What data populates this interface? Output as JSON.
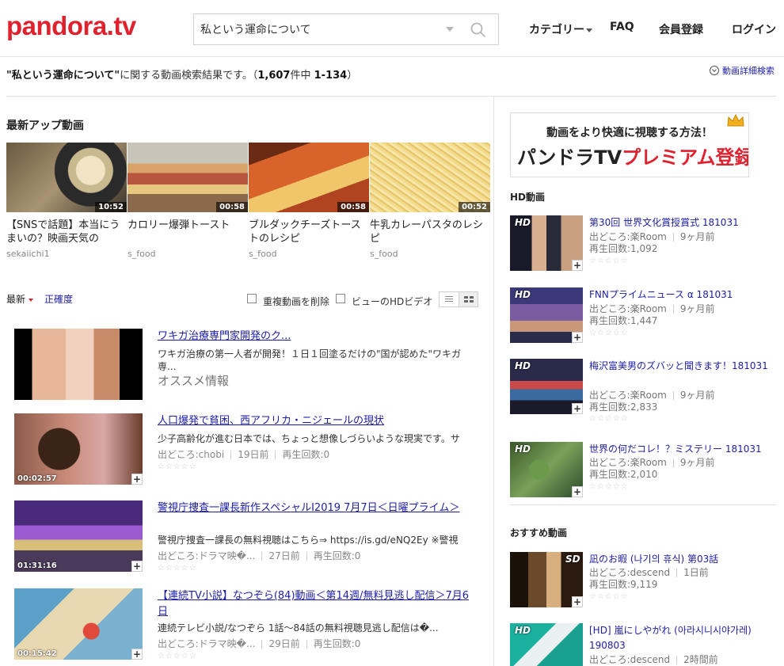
{
  "header": {
    "logo": "pandora.tv",
    "search_value": "私という運命について",
    "nav": {
      "category": "カテゴリー",
      "faq": "FAQ",
      "register": "会員登録",
      "login": "ログイン"
    }
  },
  "results": {
    "query_quoted": "\"私という運命について\"",
    "text": "に関する動画検索結果です。（",
    "total": "1,607",
    "of_label": "件中 ",
    "range": "1-134",
    "close": "）",
    "advanced": "動画詳細検索"
  },
  "latest": {
    "title": "最新アップ動画",
    "items": [
      {
        "title": "【SNSで話題】本当にうまいの？映画天気の",
        "channel": "sekaiichi1",
        "duration": "10:52"
      },
      {
        "title": "カロリー爆弾トースト",
        "channel": "s_food",
        "duration": "00:58"
      },
      {
        "title": "ブルダックチーズトーストのレシピ",
        "channel": "s_food",
        "duration": "00:58"
      },
      {
        "title": "牛乳カレーパスタのレシピ",
        "channel": "s_food",
        "duration": "00:52"
      }
    ]
  },
  "sortbar": {
    "newest": "最新",
    "accuracy": "正確度",
    "dedupe": "重複動画を削除",
    "hd_only": "ビューのHDビデオ"
  },
  "videos": [
    {
      "title": "ワキガ治療専門家開発のク...",
      "desc": "ワキガ治療の第一人者が開発！１日１回塗るだけの\"国が認めた\"ワキガ専...",
      "recommend": "オススメ情報"
    },
    {
      "title": "人口爆発で貧困、西アフリカ・ニジェールの現状",
      "desc": "少子高齢化が進む日本では、ちょっと想像しづらいような現実です。サ",
      "source": "出どころ:chobi",
      "date": "19日前",
      "views": "再生回数:0",
      "duration": "00:02:57"
    },
    {
      "title": "警視庁捜査一課長新作スペシャルⅠ2019 7月7日＜日曜プライム＞",
      "desc": "警視庁捜査一課長の無料視聴はこちら⇒ https://is.gd/eNQ2Ey ※警視",
      "source": "出どころ:ドラマ映�...",
      "date": "27日前",
      "views": "再生回数:0",
      "duration": "01:31:16"
    },
    {
      "title": "【連続TV小説】なつぞら(84)動画＜第14週/無料見逃し配信＞7月6日",
      "desc": "連続テレビ小説/なつぞら 1話～84話の無料視聴見逃し配信は�...",
      "source": "出どころ:ドラマ映�...",
      "date": "29日前",
      "views": "再生回数:0",
      "duration": "00:15:42"
    }
  ],
  "sidebar": {
    "banner_top": "動画をより快適に視聴する方法！",
    "banner_main_a": "パンドラTV",
    "banner_main_b": "プレミアム登録",
    "hd_title": "HD動画",
    "hd_items": [
      {
        "badge": "HD",
        "title": "第30回 世界文化賞授賞式 181031",
        "source": "出どころ:楽Room",
        "date": "9ヶ月前",
        "views": "再生回数:1,092"
      },
      {
        "badge": "HD",
        "title": "FNNプライムニュース α 181031",
        "source": "出どころ:楽Room",
        "date": "9ヶ月前",
        "views": "再生回数:1,447"
      },
      {
        "badge": "HD",
        "title": "梅沢富美男のズバッと聞きます！181031",
        "source": "出どころ:楽Room",
        "date": "9ヶ月前",
        "views": "再生回数:2,833"
      },
      {
        "badge": "HD",
        "title": "世界の何だコレ！？ミステリー 181031",
        "source": "出どころ:楽Room",
        "date": "9ヶ月前",
        "views": "再生回数:2,010"
      }
    ],
    "rec_title": "おすすめ動画",
    "rec_items": [
      {
        "badge": "SD",
        "title": "凪のお暇 (나기의 휴식) 第03話",
        "source": "出どころ:descend",
        "date": "1日前",
        "views": "再生回数:9,119"
      },
      {
        "badge": "HD",
        "title": "[HD] 嵐にしやがれ (아라시니시야가레) 190803",
        "source": "出どころ:descend",
        "date": "2時間前"
      }
    ]
  },
  "colors": {
    "brand": "#e0222f",
    "link": "#1d1da8"
  }
}
